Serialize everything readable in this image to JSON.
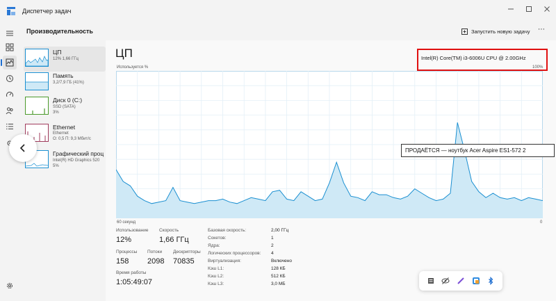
{
  "window": {
    "title": "Диспетчер задач"
  },
  "header": {
    "page_title": "Производительность",
    "run_task_label": "Запустить новую задачу"
  },
  "sidebar": {
    "items": [
      {
        "name": "ЦП",
        "sub1": "12% 1,66 ГГц",
        "color": "#1a8fd1"
      },
      {
        "name": "Память",
        "sub1": "3,2/7,9 ГБ (41%)",
        "color": "#1a8fd1"
      },
      {
        "name": "Диск 0 (C:)",
        "sub1": "SSD (SATA)",
        "sub2": "3%",
        "color": "#4b9a2b"
      },
      {
        "name": "Ethernet",
        "sub1": "Ethernet",
        "sub2": "О: 0,5 П: 9,3 Мбит/с",
        "color": "#a03b5c"
      },
      {
        "name": "Графический проц",
        "sub1": "Intel(R) HD Graphics 520",
        "sub2": "5%",
        "color": "#1a8fd1"
      }
    ]
  },
  "cpu": {
    "title": "ЦП",
    "model": "Intel(R) Core(TM) i3-6006U CPU @ 2.00GHz",
    "usage_label": "Используется %",
    "max_label": "100%",
    "axis_left": "60 секунд",
    "axis_right": "0",
    "history_percent": [
      33,
      25,
      22,
      15,
      12,
      10,
      11,
      12,
      21,
      12,
      11,
      10,
      11,
      12,
      12,
      13,
      11,
      10,
      12,
      14,
      13,
      12,
      18,
      19,
      13,
      12,
      18,
      15,
      12,
      13,
      24,
      38,
      24,
      15,
      14,
      12,
      18,
      16,
      16,
      14,
      13,
      15,
      20,
      17,
      14,
      12,
      13,
      17,
      65,
      46,
      25,
      18,
      14,
      17,
      14,
      13,
      14,
      12,
      14,
      13,
      12
    ]
  },
  "stats": {
    "utilization_label": "Использование",
    "utilization": "12%",
    "speed_label": "Скорость",
    "speed": "1,66 ГГц",
    "processes_label": "Процессы",
    "processes": "158",
    "threads_label": "Потоки",
    "threads": "2098",
    "handles_label": "Дескрипторы",
    "handles": "70835",
    "uptime_label": "Время работы",
    "uptime": "1:05:49:07"
  },
  "specs": [
    {
      "key": "Базовая скорость:",
      "value": "2,00 ГГц"
    },
    {
      "key": "Сокетов:",
      "value": "1"
    },
    {
      "key": "Ядра:",
      "value": "2"
    },
    {
      "key": "Логических процессоров:",
      "value": "4"
    },
    {
      "key": "Виртуализация:",
      "value": "Включено"
    },
    {
      "key": "Кэш L1:",
      "value": "128 КБ"
    },
    {
      "key": "Кэш L2:",
      "value": "512 КБ"
    },
    {
      "key": "Кэш L3:",
      "value": "3,0 МБ"
    }
  ],
  "overlay": {
    "banner": "ПРОДАЁТСЯ — ноутбук Acer Aspire ES1-572 2"
  },
  "colors": {
    "accent": "#1c6dd0",
    "cpu_line": "#1a8fd1",
    "cpu_fill": "#cfe9f6",
    "highlight_box": "#e01010"
  },
  "icons": {
    "nav": [
      "hamburger-icon",
      "processes-icon",
      "performance-icon",
      "app-history-icon",
      "startup-icon",
      "users-icon",
      "details-icon",
      "services-icon",
      "settings-icon"
    ],
    "toolbar": [
      "notes-icon",
      "eye-off-icon",
      "pen-icon",
      "snip-icon",
      "bluetooth-icon"
    ]
  }
}
